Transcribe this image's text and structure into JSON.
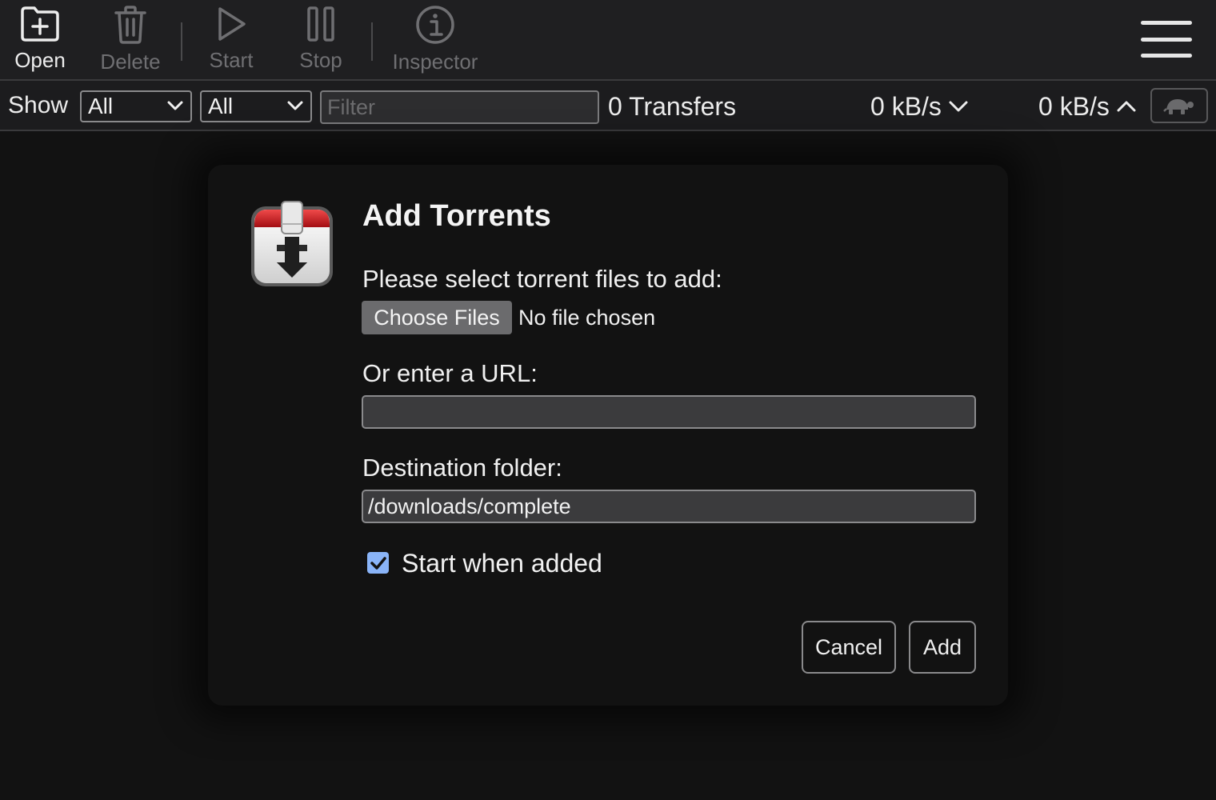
{
  "toolbar": {
    "open": {
      "label": "Open",
      "icon": "folder-plus-icon",
      "enabled": true
    },
    "delete": {
      "label": "Delete",
      "icon": "trash-icon",
      "enabled": false
    },
    "start": {
      "label": "Start",
      "icon": "play-icon",
      "enabled": false
    },
    "stop": {
      "label": "Stop",
      "icon": "pause-icon",
      "enabled": false
    },
    "inspector": {
      "label": "Inspector",
      "icon": "info-icon",
      "enabled": false
    },
    "menu_icon": "hamburger-menu-icon"
  },
  "filterbar": {
    "show_label": "Show",
    "state_select": "All",
    "tracker_select": "All",
    "filter_placeholder": "Filter",
    "transfers": "0 Transfers",
    "download_speed": "0 kB/s",
    "upload_speed": "0 kB/s",
    "speed_limit_icon": "turtle-icon"
  },
  "dialog": {
    "title": "Add Torrents",
    "file_label": "Please select torrent files to add:",
    "choose_files": "Choose Files",
    "no_file": "No file chosen",
    "url_label": "Or enter a URL:",
    "url_value": "",
    "dest_label": "Destination folder:",
    "dest_value": "/downloads/complete",
    "start_checkbox_label": "Start when added",
    "start_checked": true,
    "cancel": "Cancel",
    "add": "Add"
  },
  "colors": {
    "background": "#121212",
    "toolbar": "#1f1f21",
    "accent_checkbox": "#8ab4f8",
    "icon_red": "#c8161d"
  }
}
